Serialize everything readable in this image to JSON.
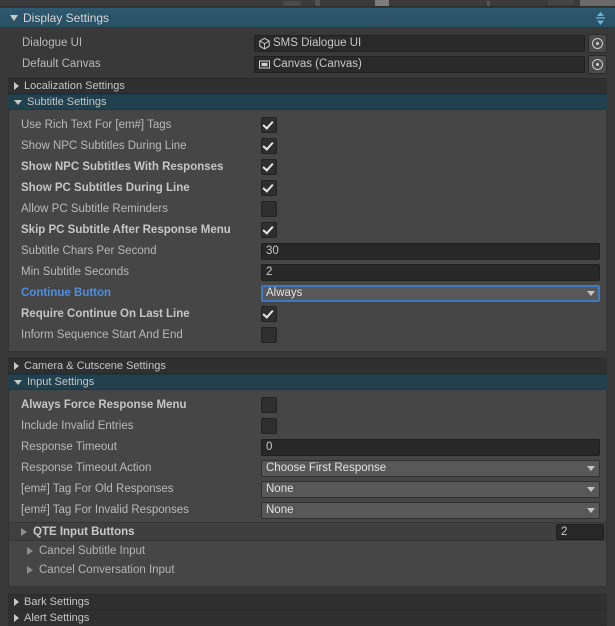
{
  "window": {
    "main_header": {
      "title": "Display Settings",
      "expanded": true,
      "sort_icon": "updown-arrows-icon"
    }
  },
  "display_settings": {
    "object_fields": [
      {
        "label": "Dialogue UI",
        "value": "SMS Dialogue UI",
        "icon": "prefab-cube-icon",
        "picker": "object-picker-icon"
      },
      {
        "label": "Default Canvas",
        "value": "Canvas (Canvas)",
        "icon": "canvas-rect-icon",
        "picker": "object-picker-icon"
      }
    ],
    "sections": [
      {
        "label": "Localization Settings",
        "expanded": false
      },
      {
        "label": "Subtitle Settings",
        "expanded": true
      },
      {
        "label": "Camera & Cutscene Settings",
        "expanded": false
      },
      {
        "label": "Input Settings",
        "expanded": true
      }
    ]
  },
  "subtitle_settings": {
    "rows": [
      {
        "label": "Use Rich Text For [em#] Tags",
        "type": "checkbox",
        "value": true,
        "bold": false
      },
      {
        "label": "Show NPC Subtitles During Line",
        "type": "checkbox",
        "value": true,
        "bold": false
      },
      {
        "label": "Show NPC Subtitles With Responses",
        "type": "checkbox",
        "value": true,
        "bold": true
      },
      {
        "label": "Show PC Subtitles During Line",
        "type": "checkbox",
        "value": true,
        "bold": true
      },
      {
        "label": "Allow PC Subtitle Reminders",
        "type": "checkbox",
        "value": false,
        "bold": false
      },
      {
        "label": "Skip PC Subtitle After Response Menu",
        "type": "checkbox",
        "value": true,
        "bold": true
      },
      {
        "label": "Subtitle Chars Per Second",
        "type": "text",
        "value": "30",
        "bold": false
      },
      {
        "label": "Min Subtitle Seconds",
        "type": "text",
        "value": "2",
        "bold": false
      },
      {
        "label": "Continue Button",
        "type": "dropdown",
        "value": "Always",
        "bold": true,
        "accent": true,
        "focused": true
      },
      {
        "label": "Require Continue On Last Line",
        "type": "checkbox",
        "value": true,
        "bold": true
      },
      {
        "label": "Inform Sequence Start And End",
        "type": "checkbox",
        "value": false,
        "bold": false
      }
    ]
  },
  "input_settings": {
    "rows": [
      {
        "label": "Always Force Response Menu",
        "type": "checkbox",
        "value": false,
        "bold": true
      },
      {
        "label": "Include Invalid Entries",
        "type": "checkbox",
        "value": false,
        "bold": false
      },
      {
        "label": "Response Timeout",
        "type": "text",
        "value": "0",
        "bold": false
      },
      {
        "label": "Response Timeout Action",
        "type": "dropdown",
        "value": "Choose First Response",
        "bold": false
      },
      {
        "label": "[em#] Tag For Old Responses",
        "type": "dropdown",
        "value": "None",
        "bold": false
      },
      {
        "label": "[em#] Tag For Invalid Responses",
        "type": "dropdown",
        "value": "None",
        "bold": false
      }
    ],
    "array_row": {
      "label": "QTE Input Buttons",
      "size": "2",
      "expanded": false
    },
    "mini_folds": [
      {
        "label": "Cancel Subtitle Input",
        "expanded": false
      },
      {
        "label": "Cancel Conversation Input",
        "expanded": false
      }
    ]
  },
  "bottom_sections": [
    {
      "label": "Bark Settings",
      "expanded": false
    },
    {
      "label": "Alert Settings",
      "expanded": false
    }
  ],
  "colors": {
    "panel_bg": "#393939",
    "header_teal": "#2c546a",
    "subheader_teal": "#21414f",
    "subheader_gray": "#303030",
    "content_box": "#464646",
    "field_dark": "#282828",
    "dropdown_gray": "#585858",
    "accent_blue": "#4e8fe0",
    "focus_border": "#3d79c4"
  }
}
